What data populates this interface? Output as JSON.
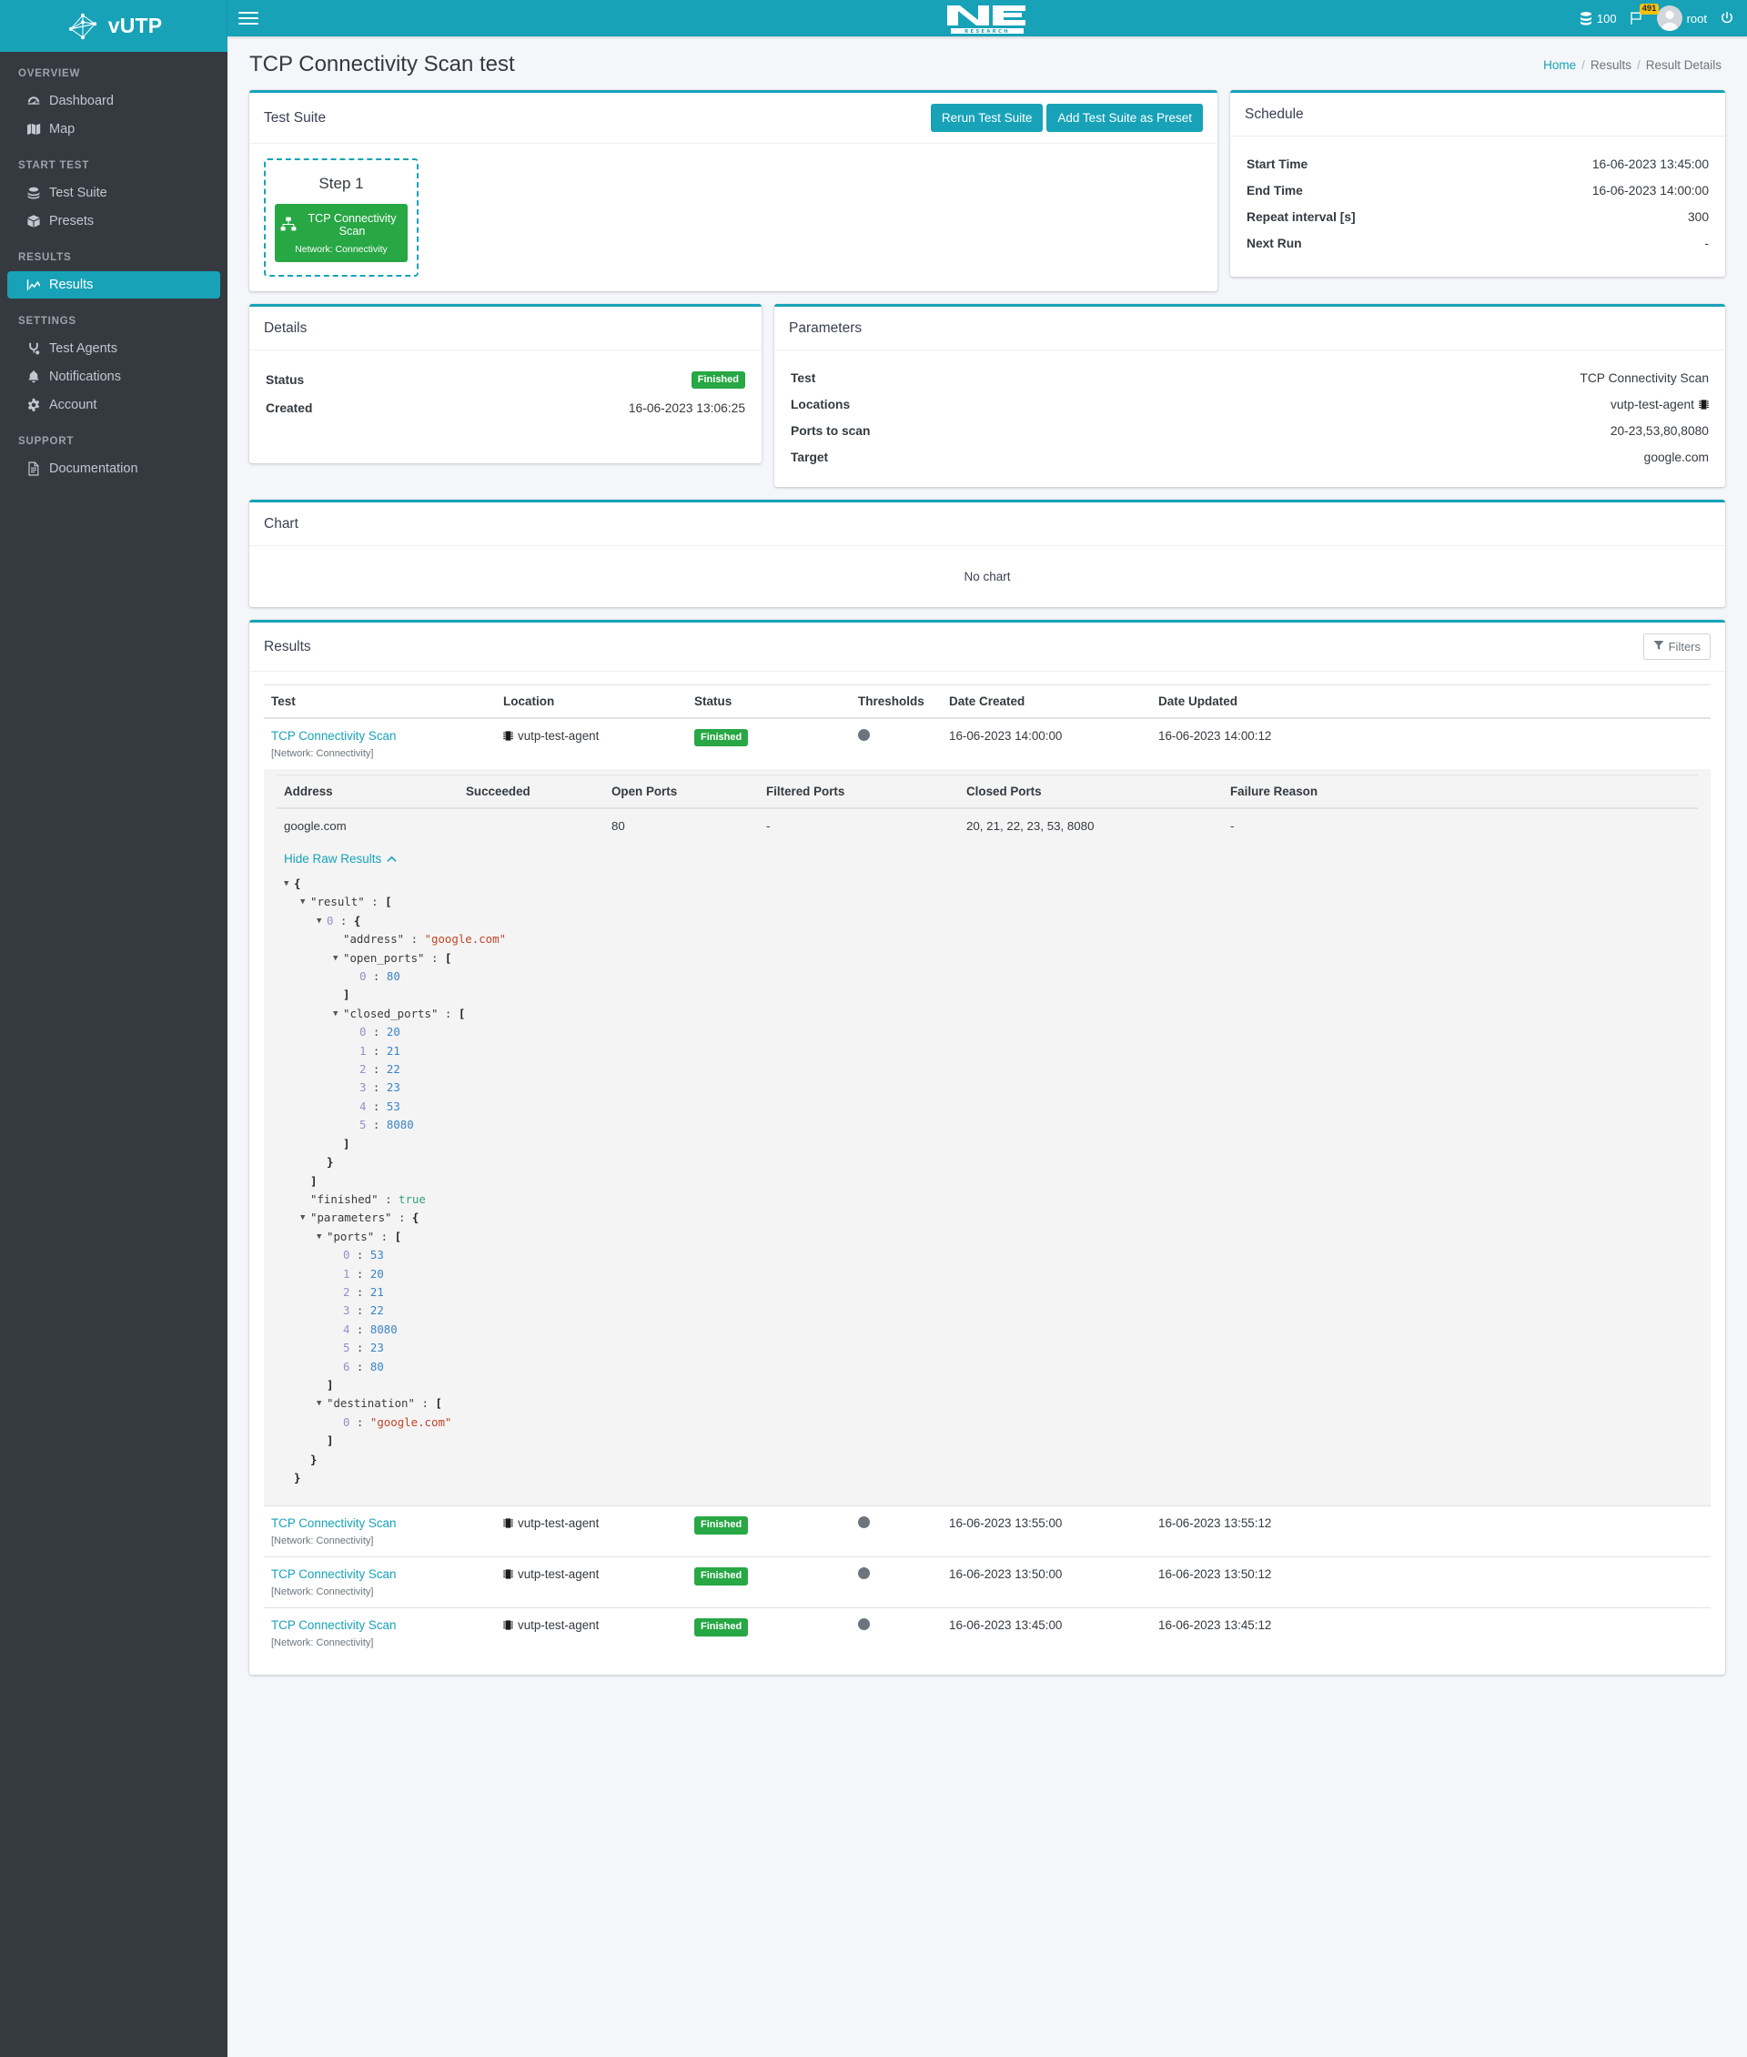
{
  "brand": {
    "name": "vUTP",
    "logo_icon": "network-graph-icon"
  },
  "topbar": {
    "menu_icon": "hamburger-icon",
    "center_logo": "net-research-logo",
    "center_logo_text": "NET",
    "center_logo_sub": "RESEARCH",
    "database_icon": "database-icon",
    "database_count": "100",
    "flag_icon": "flag-icon",
    "flag_badge": "491",
    "avatar_icon": "user-avatar-icon",
    "username": "root",
    "power_icon": "power-icon"
  },
  "sidebar": {
    "sections": [
      {
        "label": "OVERVIEW",
        "items": [
          {
            "label": "Dashboard",
            "icon": "dashboard-icon",
            "active": false
          },
          {
            "label": "Map",
            "icon": "map-icon",
            "active": false
          }
        ]
      },
      {
        "label": "START TEST",
        "items": [
          {
            "label": "Test Suite",
            "icon": "test-suite-icon",
            "active": false
          },
          {
            "label": "Presets",
            "icon": "box-icon",
            "active": false
          }
        ]
      },
      {
        "label": "RESULTS",
        "items": [
          {
            "label": "Results",
            "icon": "chart-line-icon",
            "active": true
          }
        ]
      },
      {
        "label": "SETTINGS",
        "items": [
          {
            "label": "Test Agents",
            "icon": "agents-icon",
            "active": false
          },
          {
            "label": "Notifications",
            "icon": "bell-icon",
            "active": false
          },
          {
            "label": "Account",
            "icon": "gear-icon",
            "active": false
          }
        ]
      },
      {
        "label": "SUPPORT",
        "items": [
          {
            "label": "Documentation",
            "icon": "document-icon",
            "active": false
          }
        ]
      }
    ]
  },
  "page": {
    "title": "TCP Connectivity Scan test",
    "breadcrumb": [
      {
        "label": "Home",
        "link": true
      },
      {
        "label": "Results",
        "link": false
      },
      {
        "label": "Result Details",
        "link": false
      }
    ],
    "breadcrumb_separator": "/"
  },
  "test_suite": {
    "title": "Test Suite",
    "rerun_label": "Rerun Test Suite",
    "add_preset_label": "Add Test Suite as Preset",
    "step": {
      "title": "Step 1",
      "card_icon": "sitemap-icon",
      "card_label": "TCP Connectivity Scan",
      "card_sub": "Network: Connectivity"
    }
  },
  "schedule": {
    "title": "Schedule",
    "rows": [
      {
        "key": "Start Time",
        "value": "16-06-2023 13:45:00"
      },
      {
        "key": "End Time",
        "value": "16-06-2023 14:00:00"
      },
      {
        "key": "Repeat interval [s]",
        "value": "300"
      },
      {
        "key": "Next Run",
        "value": "-"
      }
    ]
  },
  "details": {
    "title": "Details",
    "status_key": "Status",
    "status_value": "Finished",
    "created_key": "Created",
    "created_value": "16-06-2023 13:06:25"
  },
  "parameters": {
    "title": "Parameters",
    "rows": [
      {
        "key": "Test",
        "value": "TCP Connectivity Scan",
        "icon": ""
      },
      {
        "key": "Locations",
        "value": "vutp-test-agent",
        "icon": "microchip-icon"
      },
      {
        "key": "Ports to scan",
        "value": "20-23,53,80,8080",
        "icon": ""
      },
      {
        "key": "Target",
        "value": "google.com",
        "icon": ""
      }
    ]
  },
  "chart": {
    "title": "Chart",
    "empty_text": "No chart"
  },
  "results": {
    "title": "Results",
    "filters_label": "Filters",
    "filters_icon": "filter-icon",
    "columns": [
      "Test",
      "Location",
      "Status",
      "Thresholds",
      "Date Created",
      "Date Updated"
    ],
    "rows": [
      {
        "test": "TCP Connectivity Scan",
        "test_sub": "[Network: Connectivity]",
        "location": "vutp-test-agent",
        "location_icon": "microchip-icon",
        "status": "Finished",
        "threshold_icon": "status-dot-icon",
        "date_created": "16-06-2023 14:00:00",
        "date_updated": "16-06-2023 14:00:12",
        "expanded": true
      },
      {
        "test": "TCP Connectivity Scan",
        "test_sub": "[Network: Connectivity]",
        "location": "vutp-test-agent",
        "location_icon": "microchip-icon",
        "status": "Finished",
        "threshold_icon": "status-dot-icon",
        "date_created": "16-06-2023 13:55:00",
        "date_updated": "16-06-2023 13:55:12",
        "expanded": false
      },
      {
        "test": "TCP Connectivity Scan",
        "test_sub": "[Network: Connectivity]",
        "location": "vutp-test-agent",
        "location_icon": "microchip-icon",
        "status": "Finished",
        "threshold_icon": "status-dot-icon",
        "date_created": "16-06-2023 13:50:00",
        "date_updated": "16-06-2023 13:50:12",
        "expanded": false
      },
      {
        "test": "TCP Connectivity Scan",
        "test_sub": "[Network: Connectivity]",
        "location": "vutp-test-agent",
        "location_icon": "microchip-icon",
        "status": "Finished",
        "threshold_icon": "status-dot-icon",
        "date_created": "16-06-2023 13:45:00",
        "date_updated": "16-06-2023 13:45:12",
        "expanded": false
      }
    ],
    "detail": {
      "columns": [
        "Address",
        "Succeeded",
        "Open Ports",
        "Filtered Ports",
        "Closed Ports",
        "Failure Reason"
      ],
      "row": {
        "address": "google.com",
        "succeeded": "",
        "open_ports": "80",
        "filtered_ports": "-",
        "closed_ports": "20, 21, 22, 23, 53, 8080",
        "failure_reason": "-"
      },
      "raw_toggle_label": "Hide Raw Results",
      "raw_toggle_icon": "chevron-up-icon",
      "raw_lines": [
        {
          "indent": 0,
          "caret": true,
          "parts": [
            [
              "punct",
              "{"
            ]
          ]
        },
        {
          "indent": 1,
          "caret": true,
          "parts": [
            [
              "key",
              "\"result\""
            ],
            [
              "plain",
              " : "
            ],
            [
              "punct",
              "["
            ]
          ]
        },
        {
          "indent": 2,
          "caret": true,
          "parts": [
            [
              "idx",
              "0"
            ],
            [
              "plain",
              " : "
            ],
            [
              "punct",
              "{"
            ]
          ]
        },
        {
          "indent": 3,
          "caret": false,
          "parts": [
            [
              "key",
              "\"address\""
            ],
            [
              "plain",
              " : "
            ],
            [
              "str",
              "\"google.com\""
            ]
          ]
        },
        {
          "indent": 3,
          "caret": true,
          "parts": [
            [
              "key",
              "\"open_ports\""
            ],
            [
              "plain",
              " : "
            ],
            [
              "punct",
              "["
            ]
          ]
        },
        {
          "indent": 4,
          "caret": false,
          "parts": [
            [
              "idx",
              "0"
            ],
            [
              "plain",
              " : "
            ],
            [
              "num",
              "80"
            ]
          ]
        },
        {
          "indent": 3,
          "caret": false,
          "parts": [
            [
              "punct",
              "]"
            ]
          ]
        },
        {
          "indent": 3,
          "caret": true,
          "parts": [
            [
              "key",
              "\"closed_ports\""
            ],
            [
              "plain",
              " : "
            ],
            [
              "punct",
              "["
            ]
          ]
        },
        {
          "indent": 4,
          "caret": false,
          "parts": [
            [
              "idx",
              "0"
            ],
            [
              "plain",
              " : "
            ],
            [
              "num",
              "20"
            ]
          ]
        },
        {
          "indent": 4,
          "caret": false,
          "parts": [
            [
              "idx",
              "1"
            ],
            [
              "plain",
              " : "
            ],
            [
              "num",
              "21"
            ]
          ]
        },
        {
          "indent": 4,
          "caret": false,
          "parts": [
            [
              "idx",
              "2"
            ],
            [
              "plain",
              " : "
            ],
            [
              "num",
              "22"
            ]
          ]
        },
        {
          "indent": 4,
          "caret": false,
          "parts": [
            [
              "idx",
              "3"
            ],
            [
              "plain",
              " : "
            ],
            [
              "num",
              "23"
            ]
          ]
        },
        {
          "indent": 4,
          "caret": false,
          "parts": [
            [
              "idx",
              "4"
            ],
            [
              "plain",
              " : "
            ],
            [
              "num",
              "53"
            ]
          ]
        },
        {
          "indent": 4,
          "caret": false,
          "parts": [
            [
              "idx",
              "5"
            ],
            [
              "plain",
              " : "
            ],
            [
              "num",
              "8080"
            ]
          ]
        },
        {
          "indent": 3,
          "caret": false,
          "parts": [
            [
              "punct",
              "]"
            ]
          ]
        },
        {
          "indent": 2,
          "caret": false,
          "parts": [
            [
              "punct",
              "}"
            ]
          ]
        },
        {
          "indent": 1,
          "caret": false,
          "parts": [
            [
              "punct",
              "]"
            ]
          ]
        },
        {
          "indent": 1,
          "caret": false,
          "parts": [
            [
              "key",
              "\"finished\""
            ],
            [
              "plain",
              " : "
            ],
            [
              "bool",
              "true"
            ]
          ]
        },
        {
          "indent": 1,
          "caret": true,
          "parts": [
            [
              "key",
              "\"parameters\""
            ],
            [
              "plain",
              " : "
            ],
            [
              "punct",
              "{"
            ]
          ]
        },
        {
          "indent": 2,
          "caret": true,
          "parts": [
            [
              "key",
              "\"ports\""
            ],
            [
              "plain",
              " : "
            ],
            [
              "punct",
              "["
            ]
          ]
        },
        {
          "indent": 3,
          "caret": false,
          "parts": [
            [
              "idx",
              "0"
            ],
            [
              "plain",
              " : "
            ],
            [
              "num",
              "53"
            ]
          ]
        },
        {
          "indent": 3,
          "caret": false,
          "parts": [
            [
              "idx",
              "1"
            ],
            [
              "plain",
              " : "
            ],
            [
              "num",
              "20"
            ]
          ]
        },
        {
          "indent": 3,
          "caret": false,
          "parts": [
            [
              "idx",
              "2"
            ],
            [
              "plain",
              " : "
            ],
            [
              "num",
              "21"
            ]
          ]
        },
        {
          "indent": 3,
          "caret": false,
          "parts": [
            [
              "idx",
              "3"
            ],
            [
              "plain",
              " : "
            ],
            [
              "num",
              "22"
            ]
          ]
        },
        {
          "indent": 3,
          "caret": false,
          "parts": [
            [
              "idx",
              "4"
            ],
            [
              "plain",
              " : "
            ],
            [
              "num",
              "8080"
            ]
          ]
        },
        {
          "indent": 3,
          "caret": false,
          "parts": [
            [
              "idx",
              "5"
            ],
            [
              "plain",
              " : "
            ],
            [
              "num",
              "23"
            ]
          ]
        },
        {
          "indent": 3,
          "caret": false,
          "parts": [
            [
              "idx",
              "6"
            ],
            [
              "plain",
              " : "
            ],
            [
              "num",
              "80"
            ]
          ]
        },
        {
          "indent": 2,
          "caret": false,
          "parts": [
            [
              "punct",
              "]"
            ]
          ]
        },
        {
          "indent": 2,
          "caret": true,
          "parts": [
            [
              "key",
              "\"destination\""
            ],
            [
              "plain",
              " : "
            ],
            [
              "punct",
              "["
            ]
          ]
        },
        {
          "indent": 3,
          "caret": false,
          "parts": [
            [
              "idx",
              "0"
            ],
            [
              "plain",
              " : "
            ],
            [
              "str",
              "\"google.com\""
            ]
          ]
        },
        {
          "indent": 2,
          "caret": false,
          "parts": [
            [
              "punct",
              "]"
            ]
          ]
        },
        {
          "indent": 1,
          "caret": false,
          "parts": [
            [
              "punct",
              "}"
            ]
          ]
        },
        {
          "indent": 0,
          "caret": false,
          "parts": [
            [
              "punct",
              "}"
            ]
          ]
        }
      ]
    }
  },
  "colors": {
    "accent": "#17a2b8",
    "sidebar_bg": "#343a40",
    "success": "#28a745",
    "warning": "#ffc107",
    "muted": "#6c757d",
    "page_bg": "#f4f6f9"
  }
}
